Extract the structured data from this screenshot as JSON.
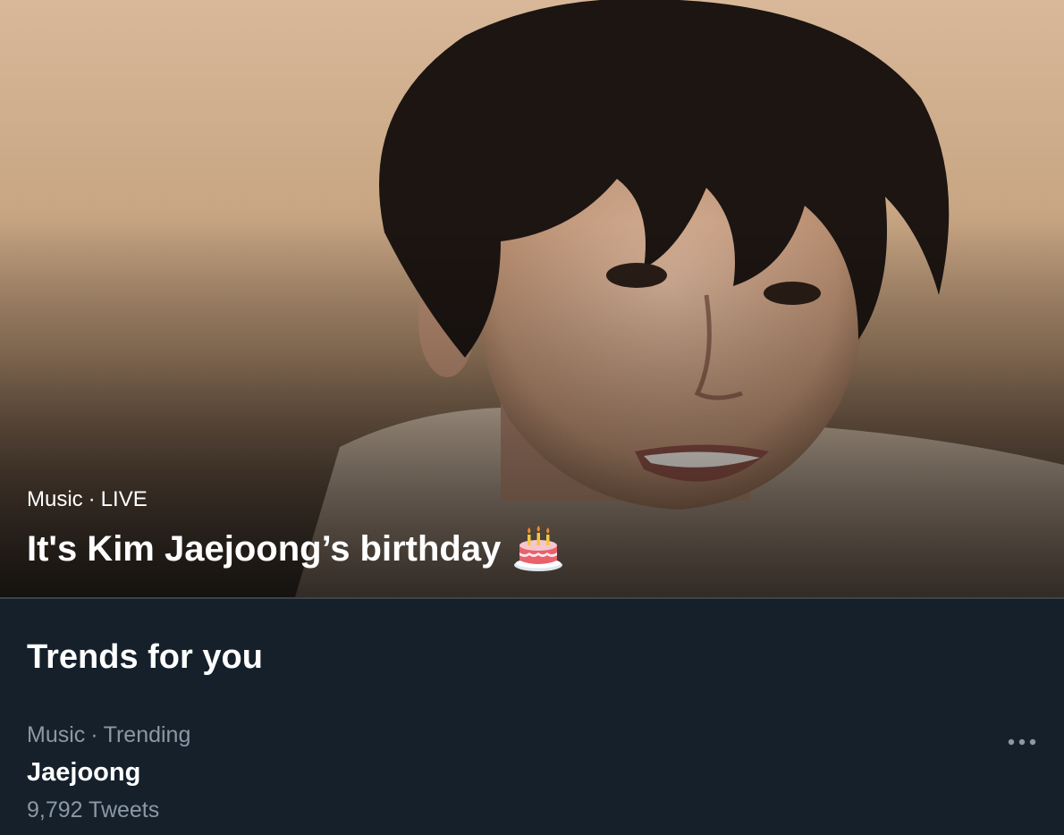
{
  "hero": {
    "category": "Music",
    "separator": "·",
    "status": "LIVE",
    "title": "It's Kim Jaejoong’s birthday",
    "emoji_icon": "birthday-cake-icon"
  },
  "trends": {
    "heading": "Trends for you",
    "items": [
      {
        "category": "Music",
        "separator": "·",
        "label": "Trending",
        "name": "Jaejoong",
        "count": "9,792 Tweets",
        "more_icon": "more-options-icon"
      }
    ]
  },
  "colors": {
    "background": "#15202b",
    "secondary_text": "#8b98a5",
    "primary_text": "#ffffff",
    "divider": "#38444d"
  }
}
